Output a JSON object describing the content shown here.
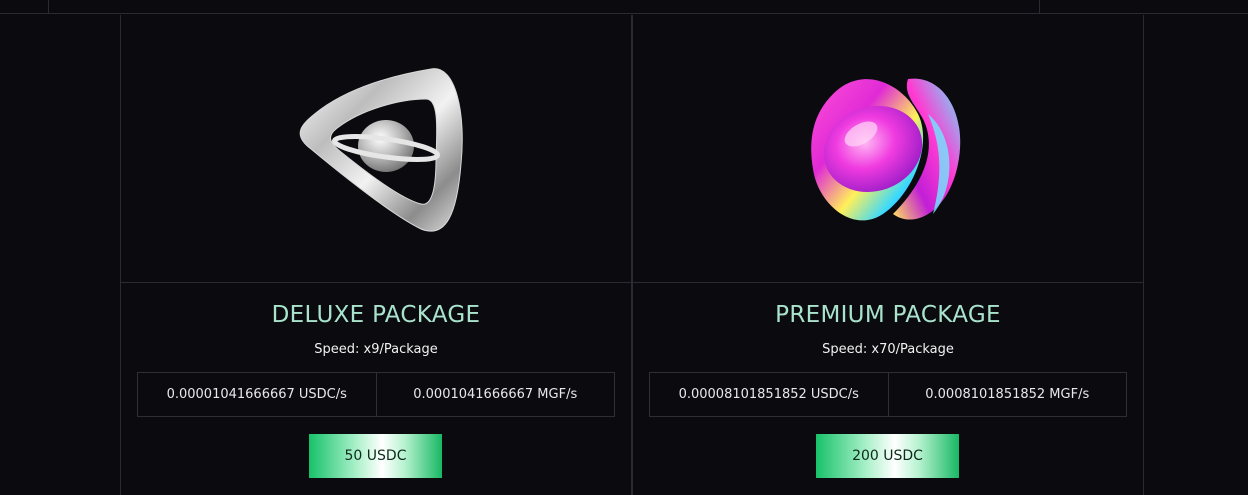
{
  "packages": [
    {
      "title": "DELUXE PACKAGE",
      "speed": "Speed: x9/Package",
      "rate_usdc": "0.00001041666667 USDC/s",
      "rate_mgf": "0.0001041666667 MGF/s",
      "price_button": "50 USDC",
      "artwork_icon": "silver-ring-orb-icon"
    },
    {
      "title": "PREMIUM PACKAGE",
      "speed": "Speed: x70/Package",
      "rate_usdc": "0.00008101851852 USDC/s",
      "rate_mgf": "0.0008101851852 MGF/s",
      "price_button": "200 USDC",
      "artwork_icon": "holographic-knot-icon"
    }
  ],
  "colors": {
    "background": "#0a0a0f",
    "title": "#a9e3cc",
    "button_green": "#17c26a",
    "border": "#2a2a30"
  }
}
